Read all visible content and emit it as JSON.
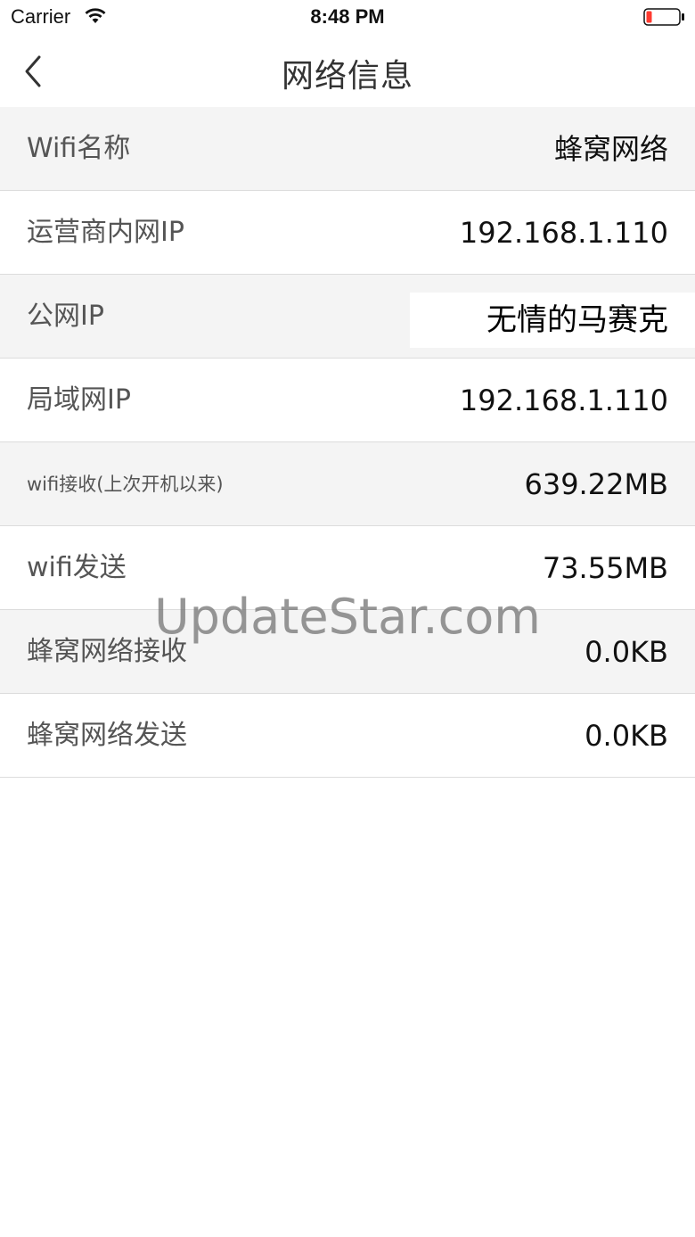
{
  "status_bar": {
    "carrier": "Carrier",
    "time": "8:48 PM",
    "wifi_icon": "wifi-icon",
    "battery_icon": "battery-low-icon",
    "battery_color": "#ff3b30"
  },
  "nav": {
    "back_icon": "chevron-left-icon",
    "title": "网络信息"
  },
  "rows": [
    {
      "label": "Wifi名称",
      "value": "蜂窝网络"
    },
    {
      "label": "运营商内网IP",
      "value": "192.168.1.110"
    },
    {
      "label": "公网IP",
      "value": "无情的马赛克"
    },
    {
      "label": "局域网IP",
      "value": "192.168.1.110"
    },
    {
      "label": "wifi接收(上次开机以来)",
      "value": "639.22MB"
    },
    {
      "label": "wifi发送",
      "value": "73.55MB"
    },
    {
      "label": "蜂窝网络接收",
      "value": "0.0KB"
    },
    {
      "label": "蜂窝网络发送",
      "value": "0.0KB"
    }
  ],
  "watermark": "UpdateStar.com"
}
